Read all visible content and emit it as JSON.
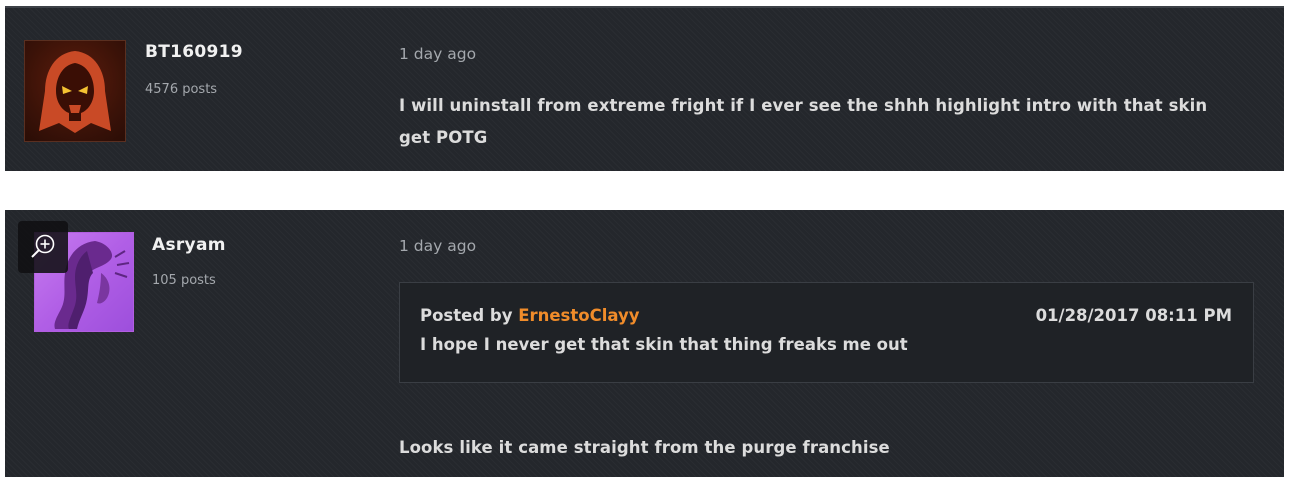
{
  "posts": [
    {
      "username": "BT160919",
      "post_count": "4576 posts",
      "timestamp": "1 day ago",
      "body_lines": [
        "I will uninstall from extreme fright if I ever see the shhh highlight intro with that skin",
        "get POTG"
      ]
    },
    {
      "username": "Asryam",
      "post_count": "105 posts",
      "timestamp": "1 day ago",
      "quote": {
        "prefix": "Posted by ",
        "author": "ErnestoClayy",
        "date": "01/28/2017 08:11 PM",
        "text": "I hope I never get that skin that thing freaks me out"
      },
      "body": "Looks like it came straight from the purge franchise"
    }
  ],
  "colors": {
    "panel_bg": "#24272c",
    "quote_author": "#f08c2a",
    "muted_text": "#a4a8ad",
    "body_text": "#dcdcdc"
  },
  "icons": {
    "avatar1": "hooded-skull-avatar-icon",
    "avatar2": "sombra-silhouette-avatar-icon",
    "zoom": "zoom-in-icon"
  }
}
